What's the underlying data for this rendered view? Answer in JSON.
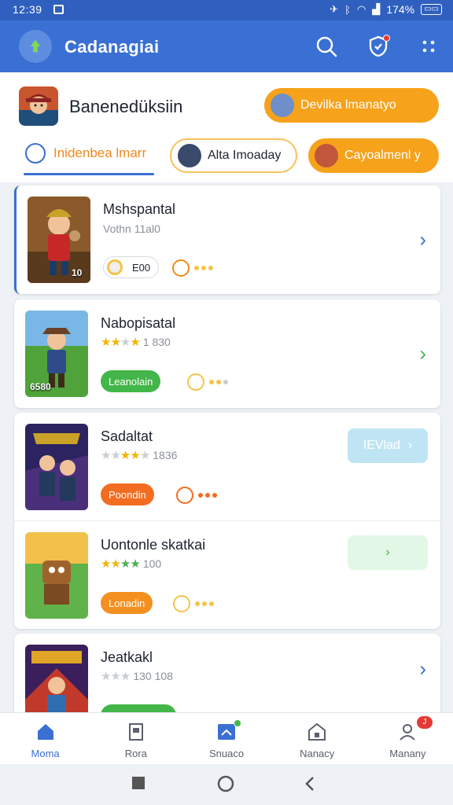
{
  "status_bar": {
    "time": "12:39",
    "battery": "174%"
  },
  "app_bar": {
    "title": "Cadanagiai"
  },
  "header": {
    "title": "Banenedüksiin",
    "pill_primary": "Devilka lmanatyo",
    "tab_active": "Inidenbea lmarr",
    "chip_outline": "Alta Imoaday",
    "chip_orange": "Cayoalmenl y"
  },
  "games": [
    {
      "title": "Mshspantal",
      "subtitle": "Vothn 11al0",
      "tag": "E00",
      "badge": "10"
    },
    {
      "title": "Nabopisatal",
      "rating_text": "1 830",
      "tag": "Leanolain",
      "badge": "6580"
    },
    {
      "title": "Sadaltat",
      "rating_text": "1836",
      "tag": "Poondin",
      "action": "IEVlad"
    },
    {
      "title": "Uontonle skatkai",
      "rating_text": "100",
      "tag": "Lonadin"
    },
    {
      "title": "Jeatkakl",
      "rating_text": "130 108"
    }
  ],
  "bottom_nav": [
    {
      "label": "Moma",
      "active": true
    },
    {
      "label": "Rora"
    },
    {
      "label": "Snuaco"
    },
    {
      "label": "Nanacy"
    },
    {
      "label": "Manany",
      "badge": "J"
    }
  ],
  "colors": {
    "primary": "#3a6fd4",
    "accent": "#f7a21b",
    "green": "#43b649",
    "orange": "#f36d21"
  }
}
